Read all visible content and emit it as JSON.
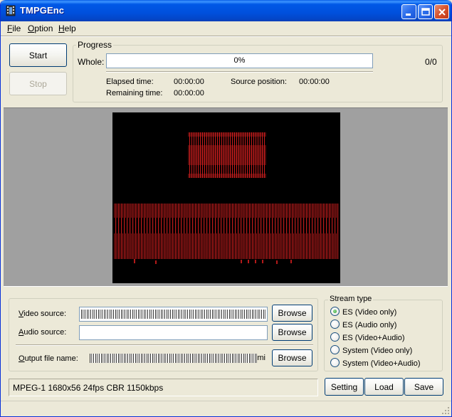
{
  "window": {
    "title": "TMPGEnc",
    "icon": "film-icon"
  },
  "menu": [
    {
      "underline": "F",
      "rest": "ile"
    },
    {
      "underline": "O",
      "rest": "ption"
    },
    {
      "underline": "H",
      "rest": "elp"
    }
  ],
  "controls": {
    "start_label": "Start",
    "stop_label": "Stop"
  },
  "progress": {
    "group_label": "Progress",
    "whole_label": "Whole:",
    "percent_text": "0%",
    "percent_value": 0,
    "count_text": "0/0",
    "elapsed_label": "Elapsed time:",
    "elapsed_value": "00:00:00",
    "remaining_label": "Remaining time:",
    "remaining_value": "00:00:00",
    "source_pos_label": "Source position:",
    "source_pos_value": "00:00:00"
  },
  "files": {
    "video_label_ul": "V",
    "video_label_rest": "ideo source:",
    "audio_label_ul": "A",
    "audio_label_rest": "udio source:",
    "audio_value": "",
    "output_label_ul": "O",
    "output_label_rest": "utput file name:",
    "output_suffix": "mi",
    "browse_label": "Browse"
  },
  "stream_type": {
    "group_label": "Stream type",
    "options": [
      {
        "label": "ES (Video only)",
        "selected": true
      },
      {
        "label": "ES (Audio only)",
        "selected": false
      },
      {
        "label": "ES (Video+Audio)",
        "selected": false
      },
      {
        "label": "System (Video only)",
        "selected": false
      },
      {
        "label": "System (Video+Audio)",
        "selected": false
      }
    ]
  },
  "summary": "MPEG-1 1680x56 24fps CBR 1150kbps",
  "actions": {
    "setting_label": "Setting",
    "load_label": "Load",
    "save_label": "Save"
  },
  "colors": {
    "titlebar": "#0054E3",
    "face": "#ECE9D8",
    "preview_bg": "#A0A0A0",
    "preview_text": "#E02020",
    "progress_fill": "#2FB62F"
  }
}
